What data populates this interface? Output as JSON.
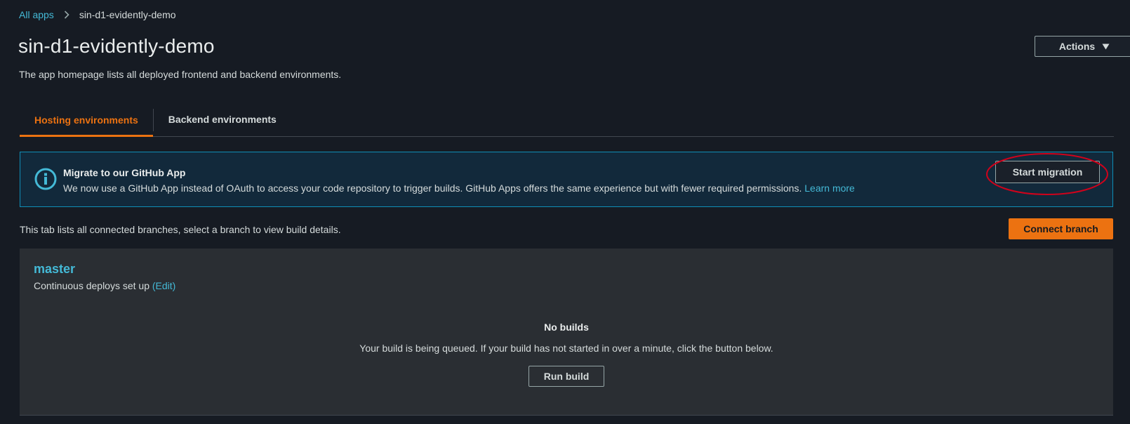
{
  "breadcrumb": {
    "root": "All apps",
    "current": "sin-d1-evidently-demo"
  },
  "header": {
    "title": "sin-d1-evidently-demo",
    "description": "The app homepage lists all deployed frontend and backend environments.",
    "actions_label": "Actions"
  },
  "tabs": [
    {
      "label": "Hosting environments",
      "active": true
    },
    {
      "label": "Backend environments",
      "active": false
    }
  ],
  "banner": {
    "title": "Migrate to our GitHub App",
    "text": "We now use a GitHub App instead of OAuth to access your code repository to trigger builds. GitHub Apps offers the same experience but with fewer required permissions.",
    "link": "Learn more",
    "button": "Start migration"
  },
  "branches": {
    "description": "This tab lists all connected branches, select a branch to view build details.",
    "connect_label": "Connect branch",
    "branch_name": "master",
    "status_text": "Continuous deploys set up",
    "edit_link": "(Edit)",
    "empty_title": "No builds",
    "empty_text": "Your build is being queued. If your build has not started in over a minute, click the button below.",
    "run_build_label": "Run build"
  },
  "colors": {
    "accent": "#ec7211",
    "link": "#44b9d6",
    "info_border": "#0f8eb7",
    "annotation": "#d0021b"
  }
}
